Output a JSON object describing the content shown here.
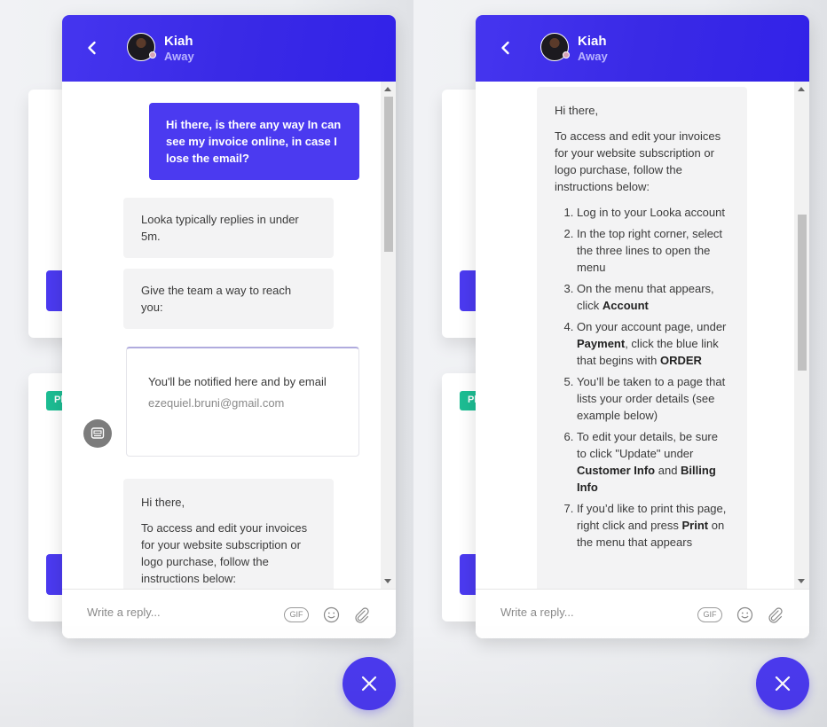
{
  "colors": {
    "brand": "#4b3af0",
    "header_gradient_start": "#4535ef",
    "header_gradient_end": "#3222e8",
    "bot_bubble": "#f3f3f4",
    "badge_green": "#1dbd93"
  },
  "background": {
    "badge_text": "Pl"
  },
  "header": {
    "back_icon": "chevron-left-icon",
    "agent_name": "Kiah",
    "agent_status": "Away"
  },
  "left_panel": {
    "messages": {
      "user_message": "Hi there, is there any way In can see my invoice online, in case I lose the email?",
      "reply_time": "Looka typically replies in under 5m.",
      "reach_prompt": "Give the team a way to reach you:",
      "notify_text": "You'll be notified here and by email",
      "notify_email": "ezequiel.bruni@gmail.com",
      "greeting": "Hi there,",
      "intro": "To access and edit your invoices for your website subscription or logo purchase, follow the instructions below:"
    },
    "scroll_position": 0.0
  },
  "right_panel": {
    "greeting": "Hi there,",
    "intro": "To access and edit your invoices for your website subscription or logo purchase, follow the instructions below:",
    "steps": [
      {
        "pre": "Log in to your Looka account",
        "bold": "",
        "post": ""
      },
      {
        "pre": "In the top right corner, select the three lines to open the menu",
        "bold": "",
        "post": ""
      },
      {
        "pre": "On the menu that appears, click ",
        "bold": "Account",
        "post": ""
      },
      {
        "pre": "On your account page, under ",
        "bold": "Payment",
        "post": ", click the blue link that begins with ",
        "bold2": "ORDER"
      },
      {
        "pre": "You’ll be taken to a page that lists your order details (see example below)",
        "bold": "",
        "post": ""
      },
      {
        "pre": "To edit your details, be sure to click \"Update\" under ",
        "bold": "Customer Info",
        "post": " and ",
        "bold2": "Billing Info"
      },
      {
        "pre": "If you’d like to print this page, right click and press ",
        "bold": "Print",
        "post": " on the menu that appears"
      }
    ],
    "scroll_position": 0.45
  },
  "composer": {
    "placeholder": "Write a reply...",
    "gif_label": "GIF",
    "emoji_icon": "smiley-icon",
    "attach_icon": "paperclip-icon"
  },
  "fab": {
    "icon": "close-icon"
  }
}
